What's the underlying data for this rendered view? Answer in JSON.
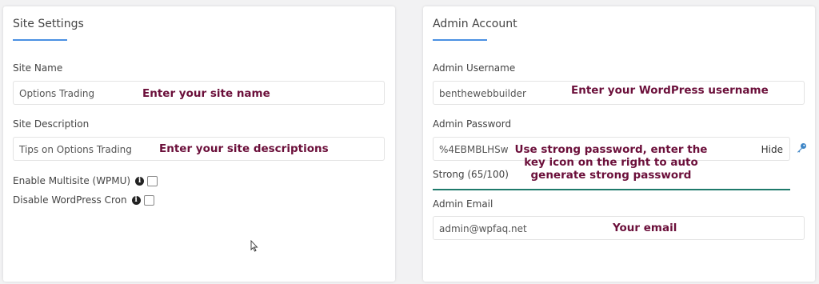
{
  "left_panel": {
    "title": "Site Settings",
    "site_name": {
      "label": "Site Name",
      "value": "Options Trading",
      "annotation": "Enter your site name"
    },
    "site_description": {
      "label": "Site Description",
      "value": "Tips on Options Trading",
      "annotation": "Enter your site descriptions"
    },
    "enable_multisite": {
      "label": "Enable Multisite (WPMU)",
      "checked": false
    },
    "disable_cron": {
      "label": "Disable WordPress Cron",
      "checked": false
    }
  },
  "right_panel": {
    "title": "Admin Account",
    "username": {
      "label": "Admin Username",
      "value": "benthewebbuilder",
      "annotation": "Enter your WordPress username"
    },
    "password": {
      "label": "Admin Password",
      "value": "%4EBMBLHSw",
      "hide_label": "Hide",
      "annotation": "Use strong password, enter the key icon on the right to auto generate strong password",
      "strength": "Strong (65/100)"
    },
    "email": {
      "label": "Admin Email",
      "value": "admin@wpfaq.net",
      "annotation": "Your email"
    }
  },
  "colors": {
    "accent": "#4a90e2",
    "annotation": "#6b0f3a",
    "strength_bar": "#1f7a6b"
  },
  "icons": [
    "info-icon",
    "key-icon",
    "cursor-icon"
  ]
}
